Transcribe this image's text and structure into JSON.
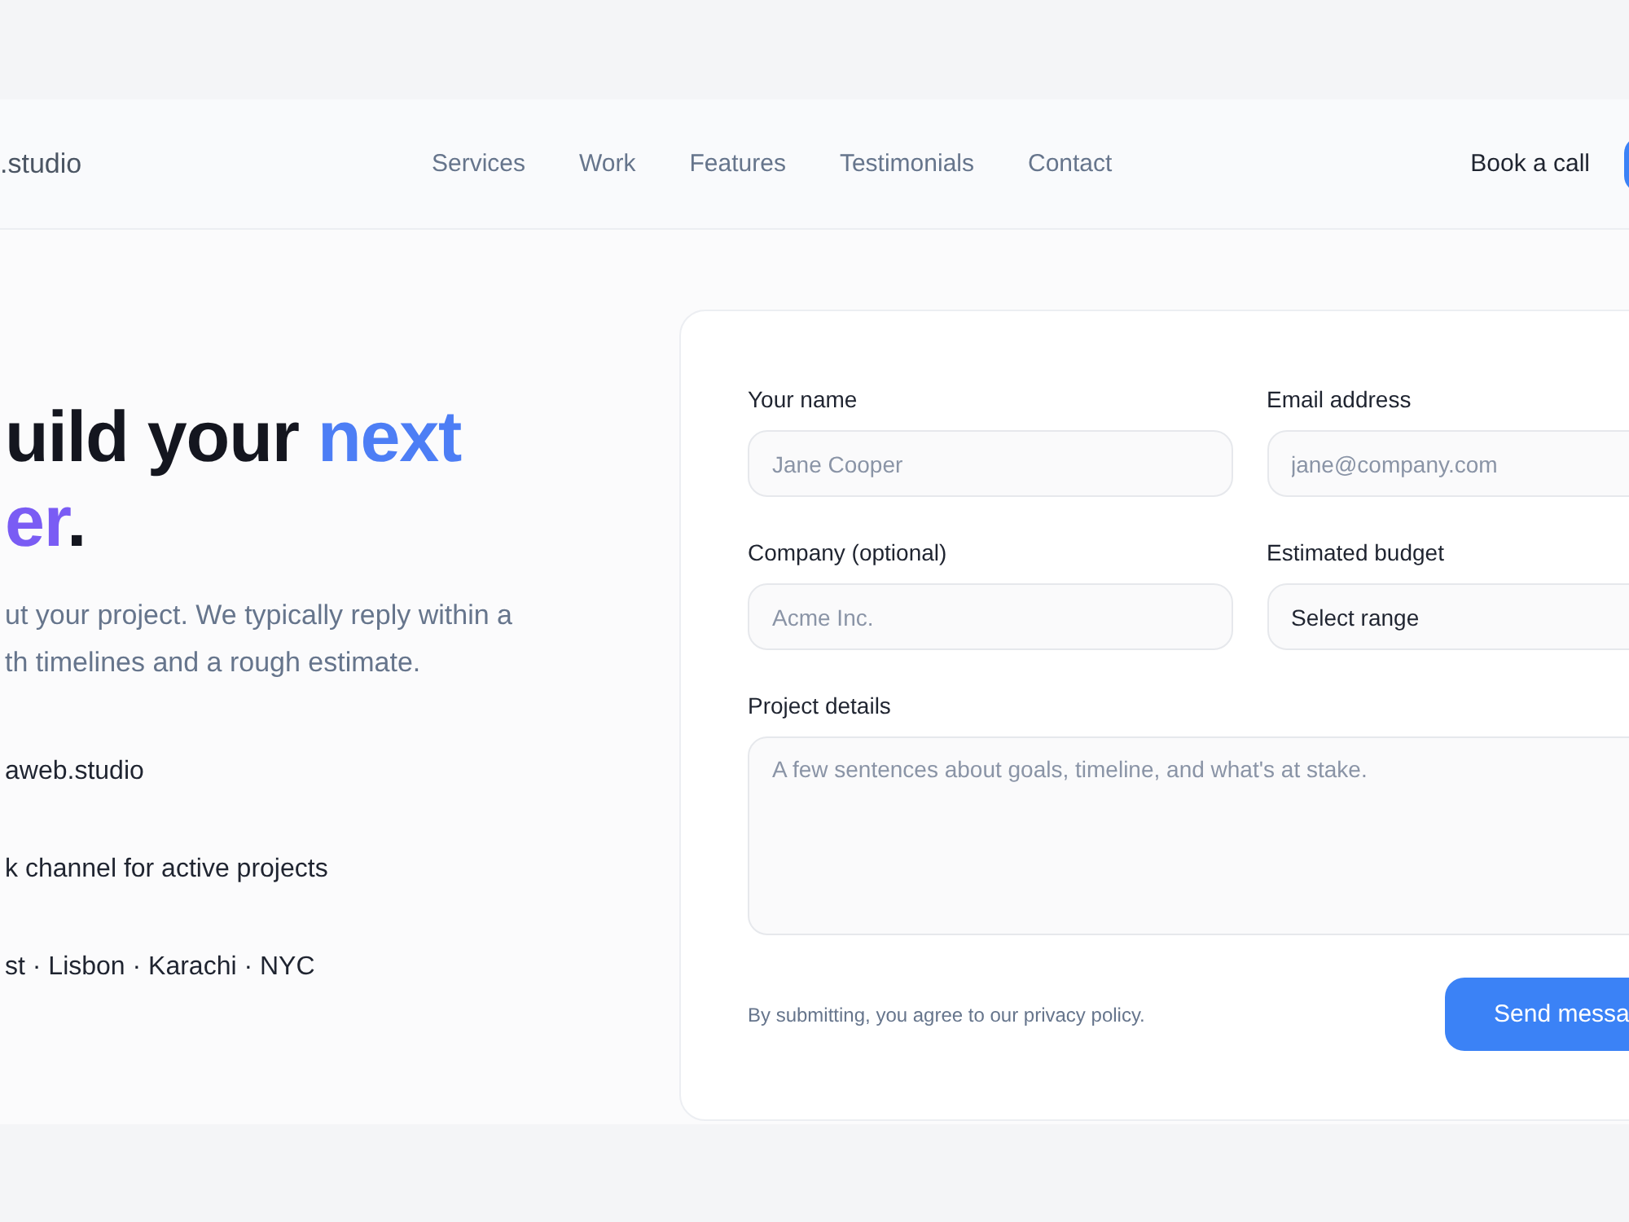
{
  "header": {
    "logo": ".studio",
    "nav": [
      "Services",
      "Work",
      "Features",
      "Testimonials",
      "Contact"
    ],
    "actions": [
      {
        "kind": "link",
        "label": "Book a call"
      },
      {
        "kind": "button"
      }
    ]
  },
  "hero": {
    "title_lines": [
      {
        "segments": [
          {
            "text": "uild your ",
            "color": "#14161f"
          },
          {
            "text": "next",
            "color": "#4d7ef5"
          }
        ]
      },
      {
        "segments": [
          {
            "text": "er",
            "color": "#7a5cf4"
          },
          {
            "text": ".",
            "color": "#14161f"
          }
        ]
      }
    ],
    "description_lines": [
      "ut your project. We typically reply within a",
      "th timelines and a rough estimate."
    ],
    "contacts": [
      "aweb.studio",
      "k channel for active projects",
      "st · Lisbon · Karachi · NYC"
    ]
  },
  "form": {
    "fields": [
      {
        "kind": "input",
        "label": "Your name",
        "placeholder": "Jane Cooper"
      },
      {
        "kind": "input",
        "label": "Email address",
        "placeholder": "jane@company.com"
      },
      {
        "kind": "input",
        "label": "Company (optional)",
        "placeholder": "Acme Inc."
      },
      {
        "kind": "select",
        "label": "Estimated budget",
        "value": "Select range"
      },
      {
        "kind": "textarea",
        "label": "Project details",
        "placeholder": "A few sentences about goals, timeline, and what's at stake."
      }
    ],
    "note": "By submitting, you agree to our privacy policy.",
    "submit": "Send messa"
  }
}
